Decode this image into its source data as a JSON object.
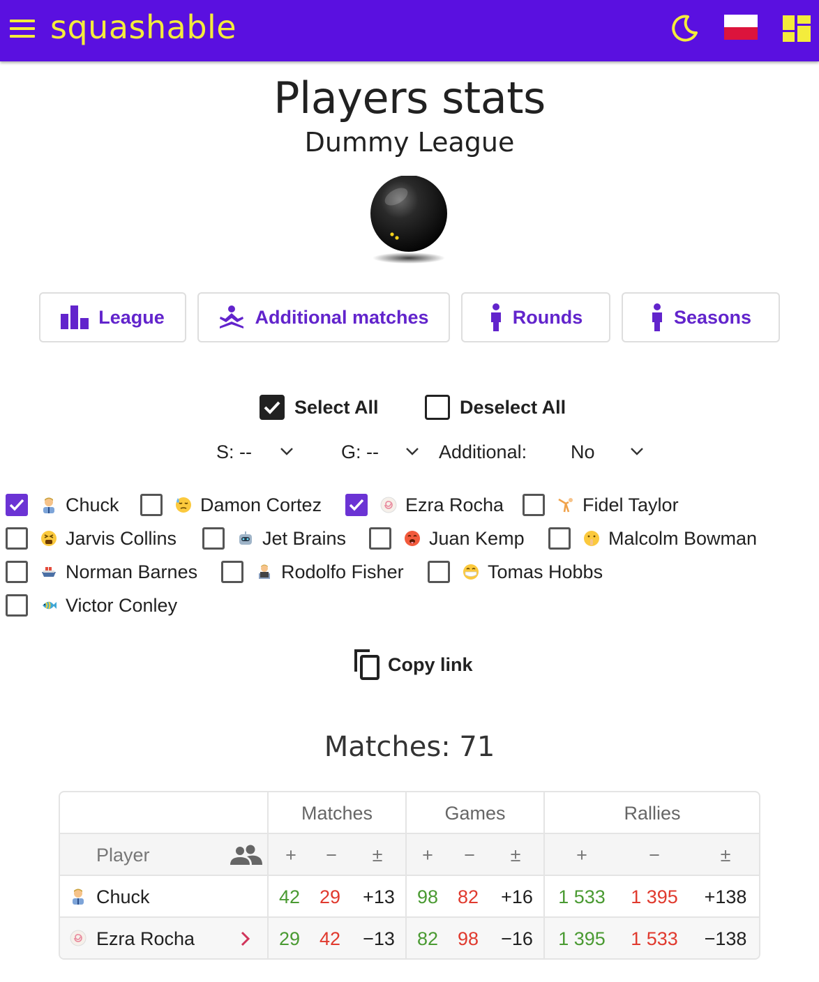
{
  "header": {
    "brand": "squashable",
    "menu_icon": "hamburger-menu-icon",
    "theme_icon": "moon-icon",
    "language_flag": "poland-flag-icon",
    "dashboard_icon": "dashboard-icon",
    "colors": {
      "bar": "#5a10e0",
      "accent": "#f4ec3c"
    }
  },
  "page": {
    "title": "Players stats",
    "subtitle": "Dummy League",
    "logo_icon": "squash-ball-icon"
  },
  "nav": [
    {
      "label": "League",
      "icon": "bar-chart-icon"
    },
    {
      "label": "Additional matches",
      "icon": "meditation-icon"
    },
    {
      "label": "Rounds",
      "icon": "person-icon"
    },
    {
      "label": "Seasons",
      "icon": "person-icon"
    }
  ],
  "selection": {
    "select_all": "Select All",
    "deselect_all": "Deselect All",
    "select_all_checked": true,
    "deselect_all_checked": false
  },
  "filters": {
    "season": "S: --",
    "group": "G: --",
    "additional_label": "Additional:",
    "additional_value": "No"
  },
  "players": [
    {
      "name": "Chuck",
      "checked": true,
      "icon": "office-worker-emoji"
    },
    {
      "name": "Damon Cortez",
      "checked": false,
      "icon": "downcast-sweat-emoji"
    },
    {
      "name": "Ezra Rocha",
      "checked": true,
      "icon": "fish-cake-emoji"
    },
    {
      "name": "Fidel Taylor",
      "checked": false,
      "icon": "cartwheel-emoji"
    },
    {
      "name": "Jarvis Collins",
      "checked": false,
      "icon": "tired-face-emoji"
    },
    {
      "name": "Jet Brains",
      "checked": false,
      "icon": "robot-emoji"
    },
    {
      "name": "Juan Kemp",
      "checked": false,
      "icon": "hot-face-emoji"
    },
    {
      "name": "Malcolm Bowman",
      "checked": false,
      "icon": "shushing-face-emoji"
    },
    {
      "name": "Norman Barnes",
      "checked": false,
      "icon": "ship-emoji"
    },
    {
      "name": "Rodolfo Fisher",
      "checked": false,
      "icon": "technologist-emoji"
    },
    {
      "name": "Tomas Hobbs",
      "checked": false,
      "icon": "mask-face-emoji"
    },
    {
      "name": "Victor Conley",
      "checked": false,
      "icon": "tropical-fish-emoji"
    }
  ],
  "copy_link": "Copy link",
  "matches_count": "Matches: 71",
  "table": {
    "groups": [
      "Matches",
      "Games",
      "Rallies"
    ],
    "player_header": "Player",
    "sub_headers": [
      "+",
      "−",
      "±",
      "+",
      "−",
      "±",
      "+",
      "−",
      "±"
    ],
    "rows": [
      {
        "name": "Chuck",
        "icon": "office-worker-emoji",
        "vals": [
          "42",
          "29",
          "+13",
          "98",
          "82",
          "+16",
          "1 533",
          "1 395",
          "+138"
        ]
      },
      {
        "name": "Ezra Rocha",
        "icon": "fish-cake-emoji",
        "vals": [
          "29",
          "42",
          "−13",
          "82",
          "98",
          "−16",
          "1 395",
          "1 533",
          "−138"
        ]
      }
    ]
  }
}
